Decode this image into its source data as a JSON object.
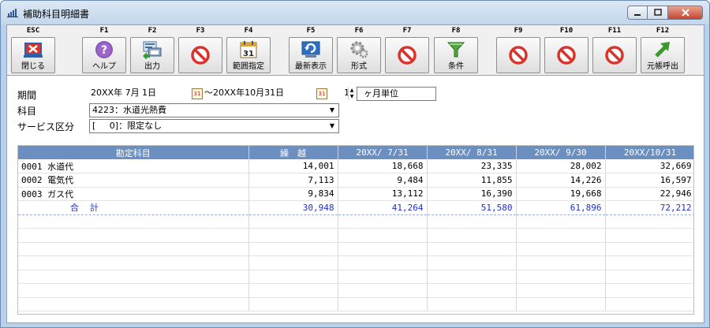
{
  "window": {
    "title": "補助科目明細書"
  },
  "toolbar": {
    "keys": [
      {
        "key": "ESC",
        "label": "閉じる",
        "icon": "close-door-icon"
      },
      {
        "key": "F1",
        "label": "ヘルプ",
        "icon": "help-icon"
      },
      {
        "key": "F2",
        "label": "出力",
        "icon": "print-output-icon"
      },
      {
        "key": "F3",
        "label": "",
        "icon": "disabled-icon"
      },
      {
        "key": "F4",
        "label": "範囲指定",
        "icon": "calendar-icon"
      },
      {
        "key": "F5",
        "label": "最新表示",
        "icon": "refresh-icon"
      },
      {
        "key": "F6",
        "label": "形式",
        "icon": "gear-icon"
      },
      {
        "key": "F7",
        "label": "",
        "icon": "disabled-icon"
      },
      {
        "key": "F8",
        "label": "条件",
        "icon": "filter-icon"
      },
      {
        "key": "F9",
        "label": "",
        "icon": "disabled-icon"
      },
      {
        "key": "F10",
        "label": "",
        "icon": "disabled-icon"
      },
      {
        "key": "F11",
        "label": "",
        "icon": "disabled-icon"
      },
      {
        "key": "F12",
        "label": "元帳呼出",
        "icon": "arrow-up-right-icon"
      }
    ],
    "calendar_day": "31"
  },
  "form": {
    "period_label": "期間",
    "period_from": "20XX年 7月 1日",
    "period_to": "～20XX年10月31日",
    "month_unit_value": "1",
    "month_unit_suffix": "ヶ月単位",
    "account_label": "科目",
    "account_value": "4223：水道光熱費",
    "service_label": "サービス区分",
    "service_value": "[     0]：限定なし"
  },
  "table": {
    "headers": [
      "勘定科目",
      "繰　越",
      "20XX/ 7/31",
      "20XX/ 8/31",
      "20XX/ 9/30",
      "20XX/10/31"
    ],
    "rows": [
      [
        "0001 水道代",
        "14,001",
        "18,668",
        "23,335",
        "28,002",
        "32,669"
      ],
      [
        "0002 電気代",
        "7,113",
        "9,484",
        "11,855",
        "14,226",
        "16,597"
      ],
      [
        "0003 ガス代",
        "9,834",
        "13,112",
        "16,390",
        "19,668",
        "22,946"
      ]
    ],
    "total": [
      "合計",
      "30,948",
      "41,264",
      "51,580",
      "61,896",
      "72,212"
    ]
  },
  "colors": {
    "header_bg": "#6a8fc0",
    "total_text": "#1f2fd0",
    "disabled_red": "#d9342b"
  }
}
